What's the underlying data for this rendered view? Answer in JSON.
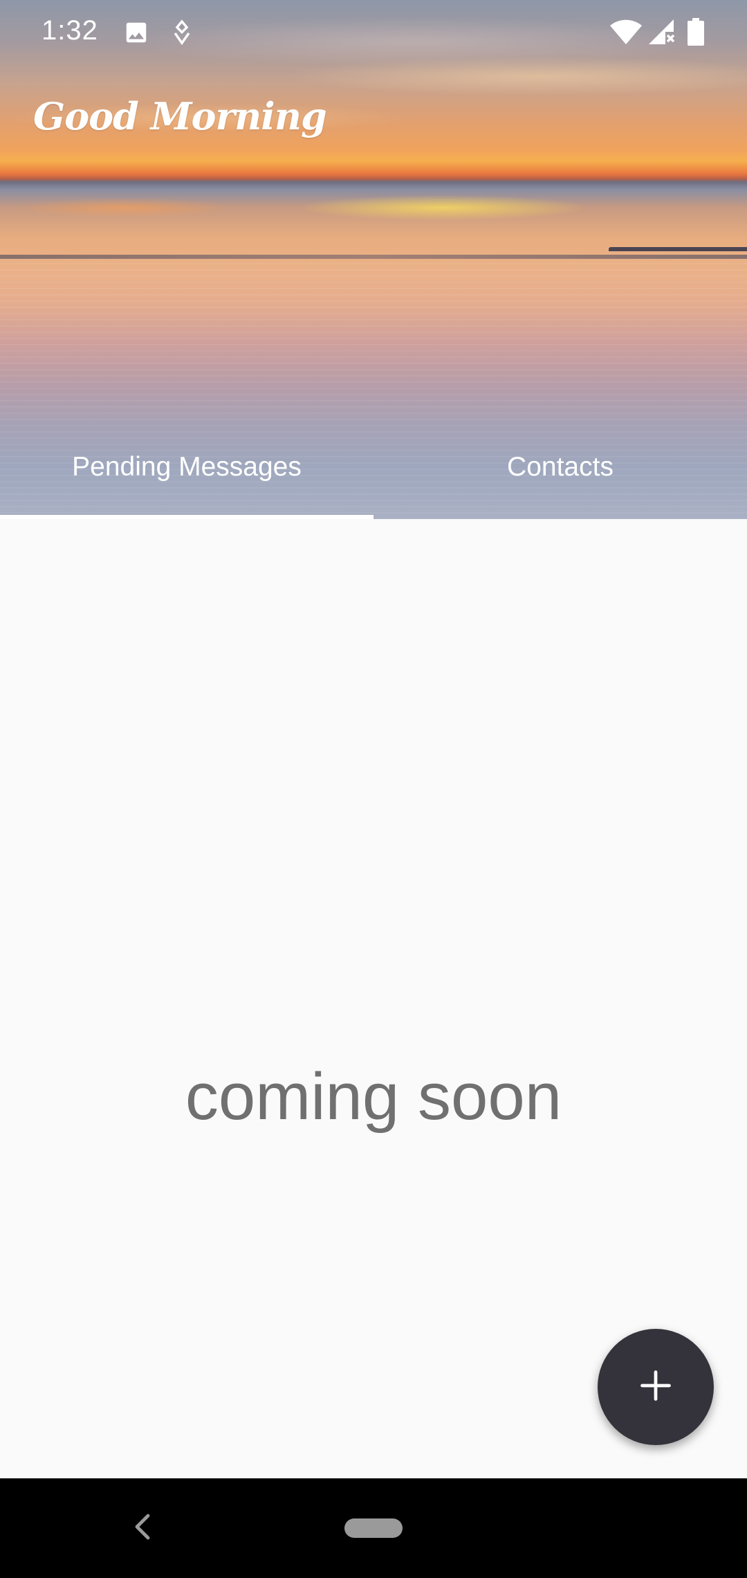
{
  "status_bar": {
    "time": "1:32",
    "icons": [
      "image-icon",
      "app-notification-icon",
      "wifi-icon",
      "signal-icon",
      "battery-icon"
    ]
  },
  "header": {
    "greeting": "Good Morning"
  },
  "tabs": [
    {
      "label": "Pending Messages",
      "selected": true
    },
    {
      "label": "Contacts",
      "selected": false
    }
  ],
  "main": {
    "message": "coming soon"
  },
  "fab": {
    "icon": "plus-icon"
  },
  "nav_bar": {
    "icons": [
      "back-icon",
      "home-pill"
    ]
  },
  "colors": {
    "fab_background": "#34323a",
    "message_text": "#707070",
    "content_background": "#fafafa"
  }
}
